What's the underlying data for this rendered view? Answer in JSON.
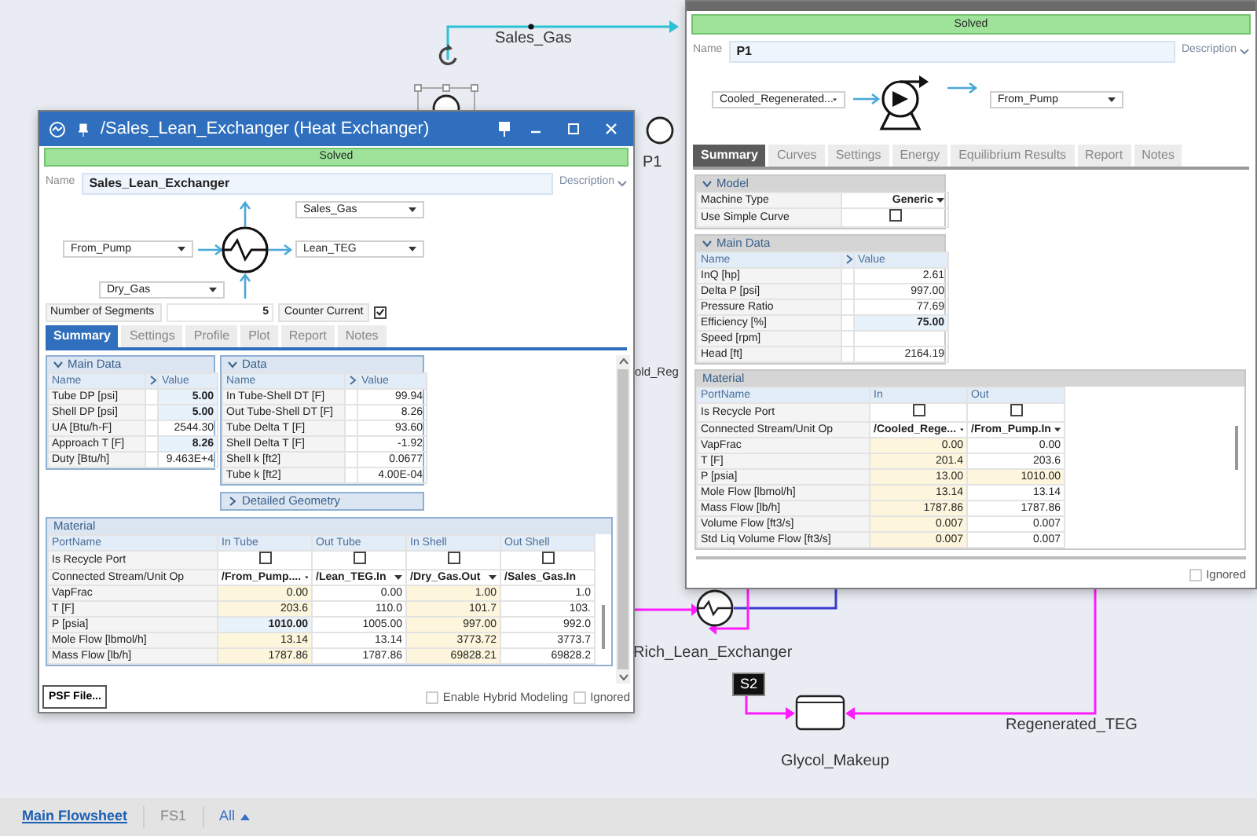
{
  "flowsheet": {
    "sales_gas_label": "Sales_Gas",
    "pump_label": "P1",
    "partial_label": "old_Reg",
    "exchanger_label": "Rich_Lean_Exchanger",
    "stream_tag": "S2",
    "makeup_label": "Glycol_Makeup",
    "regenerated_label": "Regenerated_TEG"
  },
  "exchanger_window": {
    "title": "/Sales_Lean_Exchanger (Heat Exchanger)",
    "status": "Solved",
    "name_label": "Name",
    "name": "Sales_Lean_Exchanger",
    "description": "Description",
    "ports": {
      "left_inlet": "From_Pump",
      "top_outlet": "Sales_Gas",
      "right_outlet": "Lean_TEG",
      "bottom_inlet": "Dry_Gas"
    },
    "segments_label": "Number of Segments",
    "segments": "5",
    "counter_current_label": "Counter Current",
    "counter_current": true,
    "tabs": [
      {
        "label": "Summary",
        "selected": true
      },
      {
        "label": "Settings",
        "selected": false
      },
      {
        "label": "Profile",
        "selected": false
      },
      {
        "label": "Plot",
        "selected": false
      },
      {
        "label": "Report",
        "selected": false
      },
      {
        "label": "Notes",
        "selected": false
      }
    ],
    "main_data": {
      "title": "Main Data",
      "expanded": true,
      "columns": [
        "Name",
        "Value"
      ],
      "rows": [
        {
          "name": "Tube DP [psi]",
          "value": "5.00",
          "specified": true
        },
        {
          "name": "Shell DP [psi]",
          "value": "5.00",
          "specified": true
        },
        {
          "name": "UA [Btu/h-F]",
          "value": "2544.30",
          "specified": false
        },
        {
          "name": "Approach T [F]",
          "value": "8.26",
          "specified": true
        },
        {
          "name": "Duty [Btu/h]",
          "value": "9.463E+4",
          "specified": false
        }
      ]
    },
    "data": {
      "title": "Data",
      "expanded": true,
      "columns": [
        "Name",
        "Value"
      ],
      "rows": [
        {
          "name": "In Tube-Shell DT [F]",
          "value": "99.94",
          "specified": false
        },
        {
          "name": "Out Tube-Shell DT [F]",
          "value": "8.26",
          "specified": false
        },
        {
          "name": "Tube Delta T [F]",
          "value": "93.60",
          "specified": false
        },
        {
          "name": "Shell Delta T [F]",
          "value": "-1.92",
          "specified": false
        },
        {
          "name": "Shell k [ft2]",
          "value": "0.0677",
          "specified": false
        },
        {
          "name": "Tube k [ft2]",
          "value": "4.00E-04",
          "specified": false
        }
      ]
    },
    "detailed_geometry": {
      "title": "Detailed Geometry",
      "expanded": false
    },
    "material": {
      "title": "Material",
      "name_column": "PortName",
      "columns": [
        "In Tube",
        "Out Tube",
        "In Shell",
        "Out Shell"
      ],
      "recycle_label": "Is Recycle Port",
      "recycle": [
        false,
        false,
        false,
        false
      ],
      "connected_label": "Connected Stream/Unit Op",
      "connected": [
        {
          "value": "/From_Pump....",
          "dropdown": true
        },
        {
          "value": "/Lean_TEG.In",
          "dropdown": true
        },
        {
          "value": "/Dry_Gas.Out",
          "dropdown": true
        },
        {
          "value": "/Sales_Gas.In",
          "dropdown": false
        }
      ],
      "rows": [
        {
          "name": "VapFrac",
          "cells": [
            {
              "value": "0.00",
              "highlighted": true,
              "specified": false
            },
            {
              "value": "0.00",
              "highlighted": false,
              "specified": false
            },
            {
              "value": "1.00",
              "highlighted": true,
              "specified": false
            },
            {
              "value": "1.0",
              "highlighted": false,
              "specified": false
            }
          ]
        },
        {
          "name": "T [F]",
          "cells": [
            {
              "value": "203.6",
              "highlighted": true,
              "specified": false
            },
            {
              "value": "110.0",
              "highlighted": false,
              "specified": false
            },
            {
              "value": "101.7",
              "highlighted": true,
              "specified": false
            },
            {
              "value": "103.",
              "highlighted": false,
              "specified": false
            }
          ]
        },
        {
          "name": "P [psia]",
          "cells": [
            {
              "value": "1010.00",
              "highlighted": false,
              "specified": true
            },
            {
              "value": "1005.00",
              "highlighted": false,
              "specified": false
            },
            {
              "value": "997.00",
              "highlighted": true,
              "specified": false
            },
            {
              "value": "992.0",
              "highlighted": false,
              "specified": false
            }
          ]
        },
        {
          "name": "Mole Flow [lbmol/h]",
          "cells": [
            {
              "value": "13.14",
              "highlighted": true,
              "specified": false
            },
            {
              "value": "13.14",
              "highlighted": false,
              "specified": false
            },
            {
              "value": "3773.72",
              "highlighted": true,
              "specified": false
            },
            {
              "value": "3773.7",
              "highlighted": false,
              "specified": false
            }
          ]
        },
        {
          "name": "Mass Flow [lb/h]",
          "cells": [
            {
              "value": "1787.86",
              "highlighted": true,
              "specified": false
            },
            {
              "value": "1787.86",
              "highlighted": false,
              "specified": false
            },
            {
              "value": "69828.21",
              "highlighted": true,
              "specified": false
            },
            {
              "value": "69828.2",
              "highlighted": false,
              "specified": false
            }
          ]
        }
      ]
    },
    "psf_button": "PSF File...",
    "hybrid_label": "Enable Hybrid Modeling",
    "hybrid": false,
    "ignored_label": "Ignored",
    "ignored": false
  },
  "pump_window": {
    "status": "Solved",
    "name_label": "Name",
    "name": "P1",
    "description": "Description",
    "ports": {
      "inlet": "Cooled_Regenerated...",
      "outlet": "From_Pump"
    },
    "tabs": [
      {
        "label": "Summary",
        "selected": true
      },
      {
        "label": "Curves",
        "selected": false
      },
      {
        "label": "Settings",
        "selected": false
      },
      {
        "label": "Energy",
        "selected": false
      },
      {
        "label": "Equilibrium Results",
        "selected": false
      },
      {
        "label": "Report",
        "selected": false
      },
      {
        "label": "Notes",
        "selected": false
      }
    ],
    "model": {
      "title": "Model",
      "expanded": true,
      "machine_type_label": "Machine Type",
      "machine_type": "Generic",
      "simple_curve_label": "Use Simple Curve",
      "simple_curve": false
    },
    "main_data": {
      "title": "Main Data",
      "expanded": true,
      "columns": [
        "Name",
        "Value"
      ],
      "rows": [
        {
          "name": "InQ [hp]",
          "value": "2.61",
          "specified": false
        },
        {
          "name": "Delta P [psi]",
          "value": "997.00",
          "specified": false
        },
        {
          "name": "Pressure Ratio",
          "value": "77.69",
          "specified": false
        },
        {
          "name": "Efficiency [%]",
          "value": "75.00",
          "specified": true
        },
        {
          "name": "Speed [rpm]",
          "specified": false
        },
        {
          "name": "Head [ft]",
          "value": "2164.19",
          "specified": false
        }
      ]
    },
    "material": {
      "title": "Material",
      "name_column": "PortName",
      "columns": [
        "In",
        "Out"
      ],
      "recycle_label": "Is Recycle Port",
      "recycle": [
        false,
        false
      ],
      "connected_label": "Connected Stream/Unit Op",
      "connected": [
        {
          "value": "/Cooled_Rege...",
          "dropdown": true
        },
        {
          "value": "/From_Pump.In",
          "dropdown": true
        }
      ],
      "rows": [
        {
          "name": "VapFrac",
          "cells": [
            {
              "value": "0.00",
              "highlighted": true,
              "specified": false
            },
            {
              "value": "0.00",
              "highlighted": false,
              "specified": false
            }
          ]
        },
        {
          "name": "T [F]",
          "cells": [
            {
              "value": "201.4",
              "highlighted": true,
              "specified": false
            },
            {
              "value": "203.6",
              "highlighted": false,
              "specified": false
            }
          ]
        },
        {
          "name": "P [psia]",
          "cells": [
            {
              "value": "13.00",
              "highlighted": true,
              "specified": false
            },
            {
              "value": "1010.00",
              "highlighted": true,
              "specified": false
            }
          ]
        },
        {
          "name": "Mole Flow [lbmol/h]",
          "cells": [
            {
              "value": "13.14",
              "highlighted": true,
              "specified": false
            },
            {
              "value": "13.14",
              "highlighted": false,
              "specified": false
            }
          ]
        },
        {
          "name": "Mass Flow [lb/h]",
          "cells": [
            {
              "value": "1787.86",
              "highlighted": true,
              "specified": false
            },
            {
              "value": "1787.86",
              "highlighted": false,
              "specified": false
            }
          ]
        },
        {
          "name": "Volume Flow [ft3/s]",
          "cells": [
            {
              "value": "0.007",
              "highlighted": true,
              "specified": false
            },
            {
              "value": "0.007",
              "highlighted": false,
              "specified": false
            }
          ]
        },
        {
          "name": "Std Liq Volume Flow [ft3/s]",
          "cells": [
            {
              "value": "0.007",
              "highlighted": true,
              "specified": false
            },
            {
              "value": "0.007",
              "highlighted": false,
              "specified": false
            }
          ]
        }
      ]
    },
    "ignored_label": "Ignored",
    "ignored": false
  },
  "bottom_tabs": [
    {
      "label": "Main Flowsheet",
      "selected": true,
      "kind": "tab"
    },
    {
      "label": "FS1",
      "selected": false,
      "kind": "tab"
    },
    {
      "label": "All",
      "selected": false,
      "kind": "menu"
    }
  ]
}
